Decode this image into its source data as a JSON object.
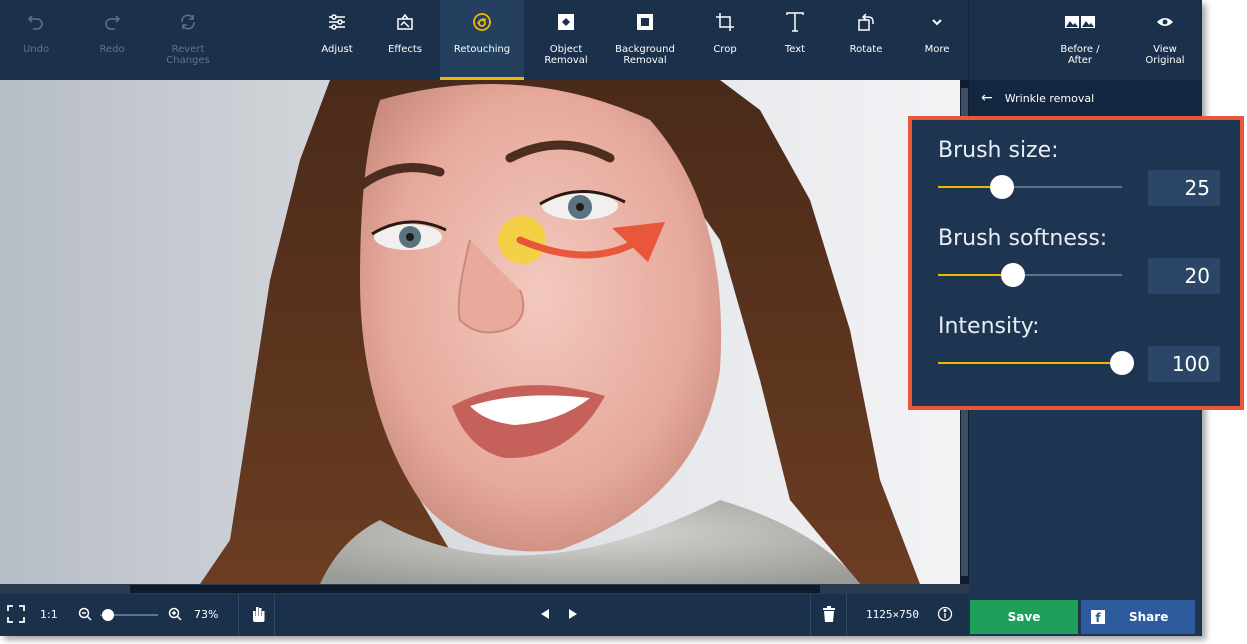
{
  "toolbar": {
    "undo": "Undo",
    "redo": "Redo",
    "revert": "Revert\nChanges",
    "adjust": "Adjust",
    "effects": "Effects",
    "retouching": "Retouching",
    "object_removal": "Object\nRemoval",
    "background_removal": "Background\nRemoval",
    "crop": "Crop",
    "text": "Text",
    "rotate": "Rotate",
    "more": "More",
    "before_after": "Before /\nAfter",
    "view_original": "View\nOriginal"
  },
  "panel": {
    "title": "Wrinkle removal",
    "brush_size": {
      "label": "Brush size:",
      "value": "25",
      "fraction": 0.35
    },
    "brush_softness": {
      "label": "Brush softness:",
      "value": "20",
      "fraction": 0.41
    },
    "intensity": {
      "label": "Intensity:",
      "value": "100",
      "fraction": 1.0
    }
  },
  "bottom": {
    "one_to_one": "1:1",
    "zoom": "73%",
    "dimensions": "1125×750",
    "save": "Save",
    "share": "Share"
  },
  "colors": {
    "accent": "#f2b705",
    "highlight": "#e8573a",
    "save": "#1fa05a",
    "share": "#2e5a9e"
  }
}
